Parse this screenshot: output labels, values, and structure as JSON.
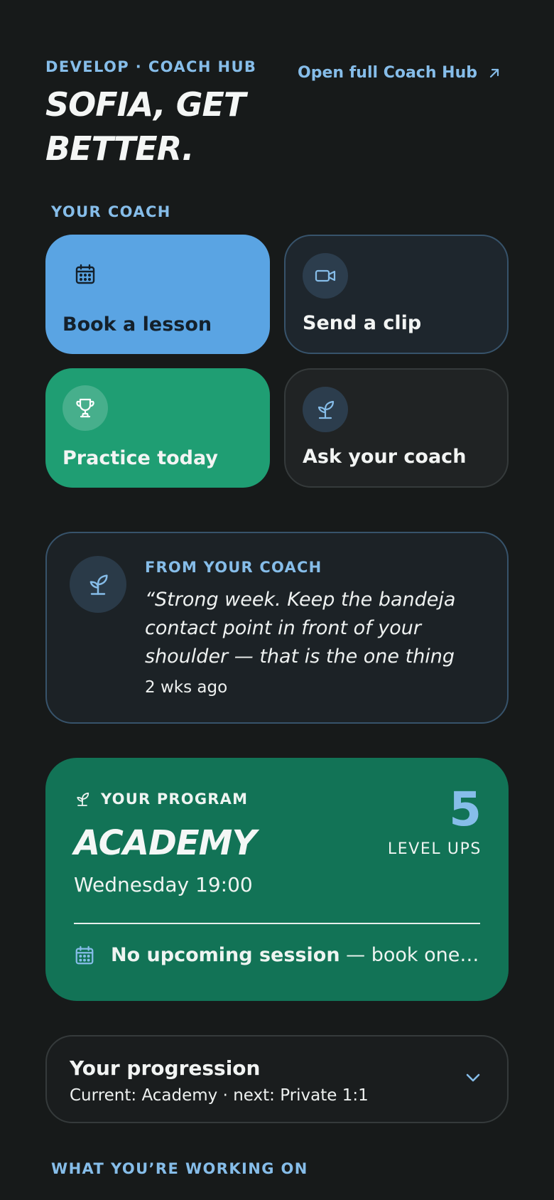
{
  "header": {
    "eyebrow": "DEVELOP · COACH HUB",
    "title": "SOFIA, GET BETTER.",
    "open_link": "Open full Coach Hub"
  },
  "your_coach_label": "YOUR COACH",
  "tiles": [
    {
      "label": "Book a lesson",
      "icon": "calendar-icon"
    },
    {
      "label": "Send a clip",
      "icon": "video-icon"
    },
    {
      "label": "Practice today",
      "icon": "trophy-icon"
    },
    {
      "label": "Ask your coach",
      "icon": "sprout-icon"
    }
  ],
  "coach_message": {
    "eyebrow": "FROM YOUR COACH",
    "quote": "“Strong week. Keep the bandeja contact point in front of your shoulder — that is the one thing to…",
    "time": "2 wks ago",
    "icon": "sprout-icon"
  },
  "program": {
    "eyebrow": "YOUR PROGRAM",
    "name": "ACADEMY",
    "schedule": "Wednesday 19:00",
    "level_ups_count": "5",
    "level_ups_label": "LEVEL UPS",
    "session_bold": "No upcoming session",
    "session_rest": " — book one u..."
  },
  "progression": {
    "title": "Your progression",
    "subtitle": "Current: Academy · next: Private 1:1"
  },
  "working_on_label": "WHAT YOU’RE WORKING ON",
  "colors": {
    "background": "#171a1a",
    "accent_blue": "#86bde9",
    "tile_blue": "#5aa4e3",
    "tile_green": "#1f9e73",
    "program_green": "#127356"
  }
}
